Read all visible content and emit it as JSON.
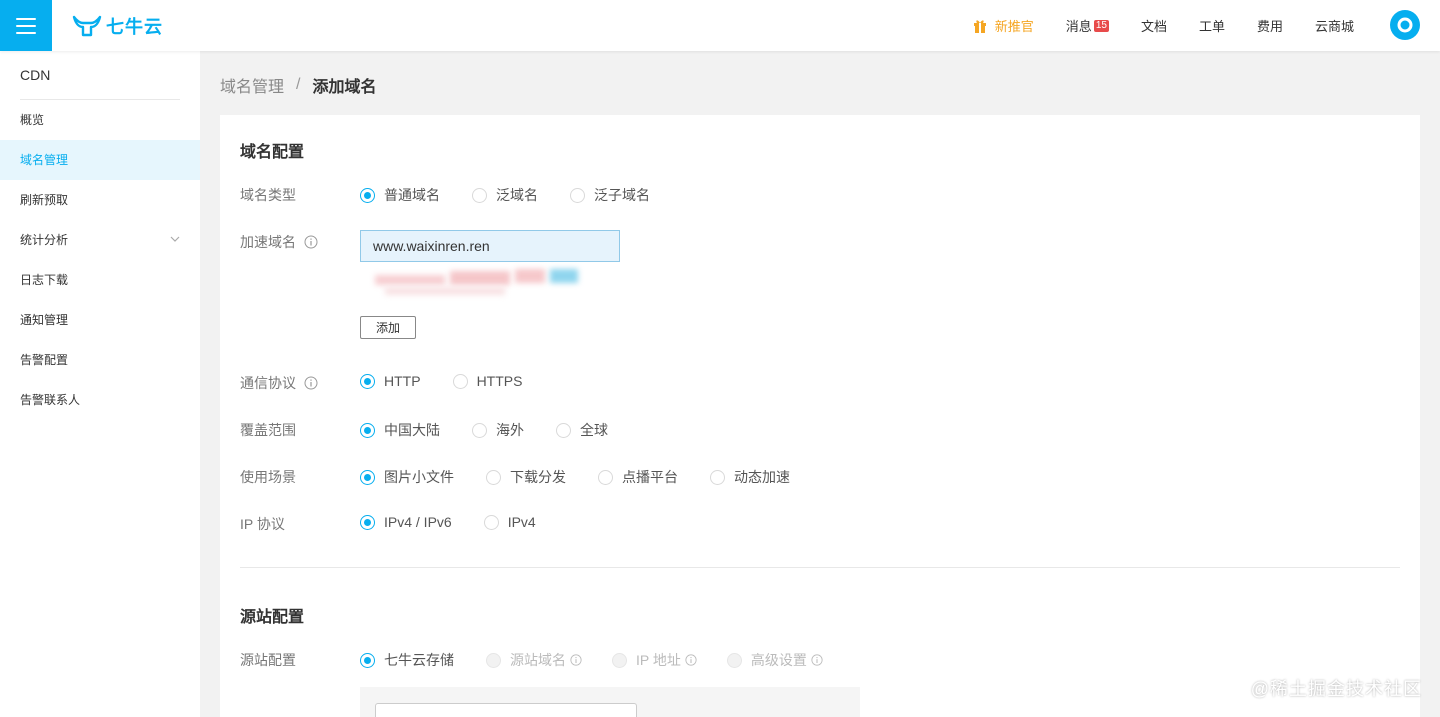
{
  "header": {
    "logo_text": "七牛云",
    "nav": {
      "promo": "新推官",
      "messages": "消息",
      "message_count": "15",
      "docs": "文档",
      "tickets": "工单",
      "billing": "费用",
      "marketplace": "云商城"
    },
    "colors": {
      "brand": "#06aeef",
      "promo": "#f5a623",
      "badge": "#e84b4b"
    }
  },
  "sidebar": {
    "title": "CDN",
    "items": [
      {
        "label": "概览"
      },
      {
        "label": "域名管理",
        "active": true
      },
      {
        "label": "刷新预取"
      },
      {
        "label": "统计分析",
        "icon": "chevron-down-icon"
      },
      {
        "label": "日志下载"
      },
      {
        "label": "通知管理"
      },
      {
        "label": "告警配置"
      },
      {
        "label": "告警联系人"
      }
    ]
  },
  "breadcrumb": {
    "parent": "域名管理",
    "separator": "/",
    "current": "添加域名"
  },
  "domain_config": {
    "title": "域名配置",
    "domain_type": {
      "label": "域名类型",
      "options": [
        "普通域名",
        "泛域名",
        "泛子域名"
      ],
      "selected": "普通域名"
    },
    "accel_domain": {
      "label": "加速域名",
      "value": "www.waixinren.ren",
      "add_button": "添加"
    },
    "protocol": {
      "label": "通信协议",
      "options": [
        "HTTP",
        "HTTPS"
      ],
      "selected": "HTTP"
    },
    "coverage": {
      "label": "覆盖范围",
      "options": [
        "中国大陆",
        "海外",
        "全球"
      ],
      "selected": "中国大陆"
    },
    "scenario": {
      "label": "使用场景",
      "options": [
        "图片小文件",
        "下载分发",
        "点播平台",
        "动态加速"
      ],
      "selected": "图片小文件"
    },
    "ip_protocol": {
      "label": "IP 协议",
      "options": [
        "IPv4 / IPv6",
        "IPv4"
      ],
      "selected": "IPv4 / IPv6"
    }
  },
  "origin_config": {
    "title": "源站配置",
    "origin": {
      "label": "源站配置",
      "options": [
        "七牛云存储",
        "源站域名",
        "IP 地址",
        "高级设置"
      ],
      "selected": "七牛云存储"
    }
  },
  "watermark": "@稀土掘金技术社区"
}
